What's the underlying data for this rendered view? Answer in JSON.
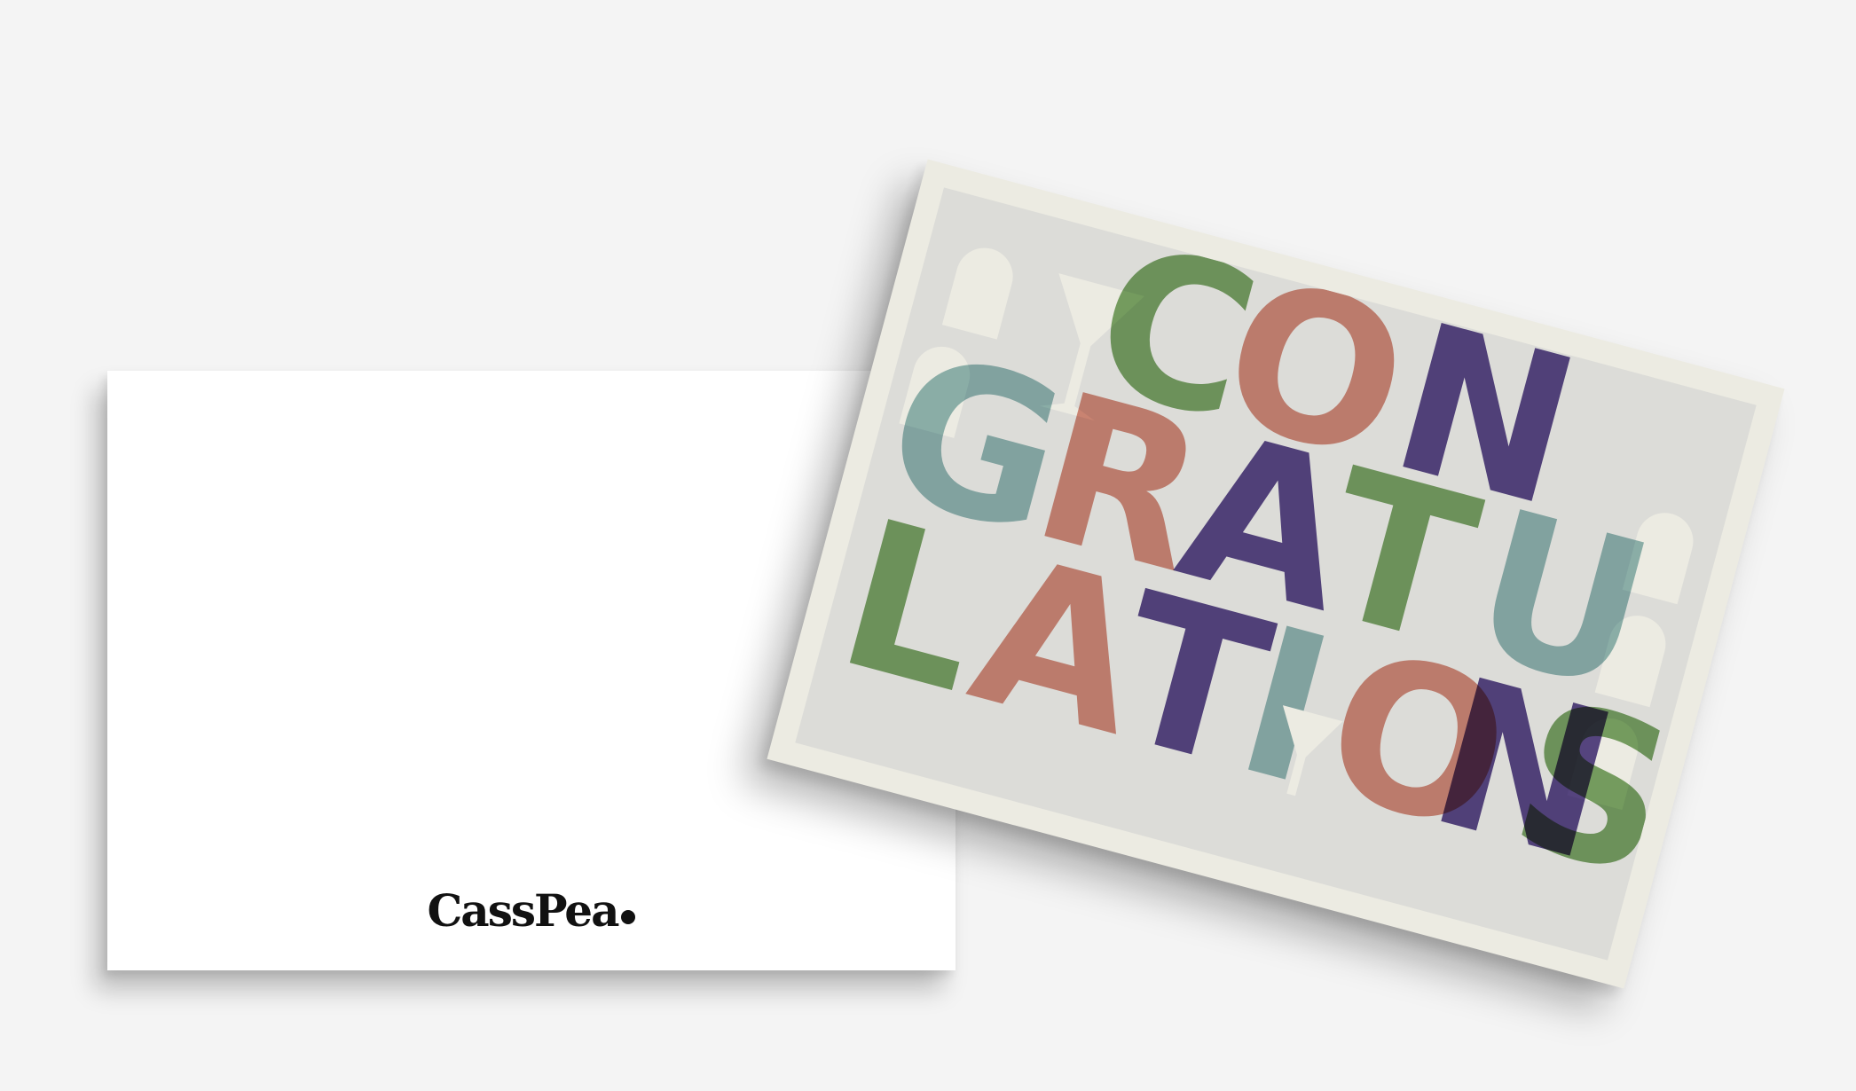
{
  "back_card": {
    "brand": "CassPea"
  },
  "front_card": {
    "letters": [
      {
        "char": "C",
        "color": "#7da86a"
      },
      {
        "char": "O",
        "color": "#d98e7f"
      },
      {
        "char": "N",
        "color": "#5c4a8e"
      },
      {
        "char": "G",
        "color": "#95bcbc"
      },
      {
        "char": "R",
        "color": "#d98e7f"
      },
      {
        "char": "A",
        "color": "#5c4a8e"
      },
      {
        "char": "T",
        "color": "#7da86a"
      },
      {
        "char": "U",
        "color": "#95bcbc"
      },
      {
        "char": "L",
        "color": "#7da86a"
      },
      {
        "char": "A",
        "color": "#d98e7f"
      },
      {
        "char": "T",
        "color": "#5c4a8e"
      },
      {
        "char": "I",
        "color": "#95bcbc"
      },
      {
        "char": "O",
        "color": "#d98e7f"
      },
      {
        "char": "N",
        "color": "#5c4a8e"
      },
      {
        "char": "S",
        "color": "#7da86a"
      }
    ],
    "icons": [
      "cocktail-glass-icon",
      "cocktail-glass-icon",
      "arch-window-icon"
    ]
  }
}
